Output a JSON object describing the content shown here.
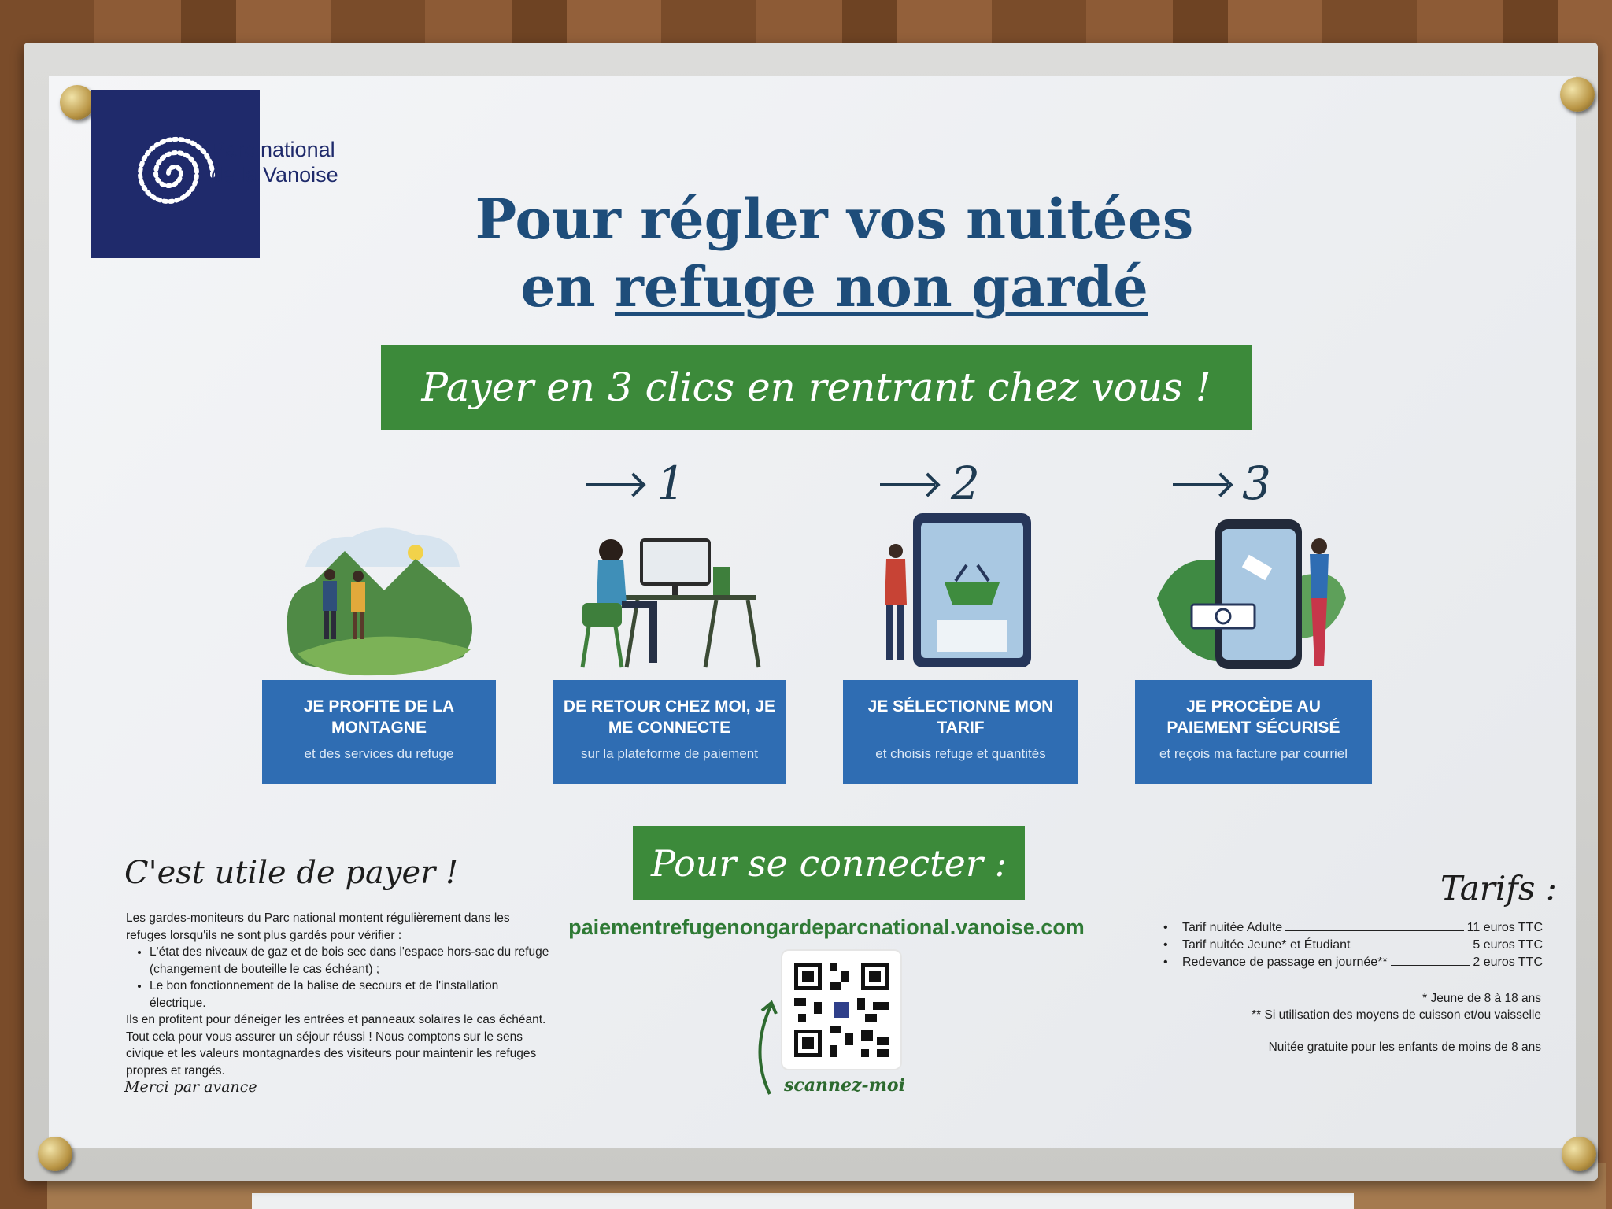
{
  "logo": {
    "line1": "Parc national",
    "line2": "de la Vanoise"
  },
  "title": {
    "line1": "Pour régler vos nuitées",
    "line2_prefix": "en ",
    "line2_underlined": "refuge non gardé"
  },
  "banner_top": "Payer en 3 clics en rentrant chez vous !",
  "steps": [
    {
      "number": "1"
    },
    {
      "number": "2"
    },
    {
      "number": "3"
    }
  ],
  "boxes": [
    {
      "heading": "JE PROFITE DE LA MONTAGNE",
      "sub": "et des services du refuge"
    },
    {
      "heading": "DE RETOUR CHEZ MOI, JE ME CONNECTE",
      "sub": "sur la plateforme de paiement"
    },
    {
      "heading": "JE SÉLECTIONNE MON TARIF",
      "sub": "et choisis refuge et quantités"
    },
    {
      "heading": "JE PROCÈDE AU PAIEMENT SÉCURISÉ",
      "sub": "et reçois ma facture par courriel"
    }
  ],
  "banner_connect": "Pour se connecter :",
  "url": "paiementrefugenongardeparcnational.vanoise.com",
  "scan_label": "scannez-moi",
  "left": {
    "title": "C'est utile de payer !",
    "intro": "Les gardes-moniteurs du Parc national montent régulièrement dans les refuges lorsqu'ils ne sont plus gardés pour vérifier :",
    "bullets": [
      "L'état des niveaux de gaz et de bois sec dans l'espace hors-sac du refuge (changement de bouteille le cas échéant) ;",
      "Le bon fonctionnement de la balise de secours et de l'installation électrique."
    ],
    "outro": "Ils en profitent pour déneiger les entrées et panneaux solaires le cas échéant. Tout cela pour vous assurer un séjour réussi ! Nous comptons sur le sens civique et les valeurs montagnardes des visiteurs pour maintenir les refuges propres et rangés.",
    "merci": "Merci par avance"
  },
  "tarifs": {
    "title": "Tarifs :",
    "rows": [
      {
        "label": "Tarif  nuitée Adulte",
        "value": "11 euros TTC"
      },
      {
        "label": "Tarif nuitée Jeune* et Étudiant",
        "value": "5 euros TTC"
      },
      {
        "label": "Redevance de passage  en journée**",
        "value": "2 euros TTC"
      }
    ],
    "note1": "* Jeune de 8 à 18 ans",
    "note2": "** Si utilisation des moyens de cuisson et/ou vaisselle",
    "note3": "Nuitée gratuite pour les enfants de moins de 8 ans"
  },
  "colors": {
    "navy": "#1f2a6b",
    "title_blue": "#1e4d7a",
    "green": "#3c8a3a",
    "box_blue": "#2f6db3"
  }
}
